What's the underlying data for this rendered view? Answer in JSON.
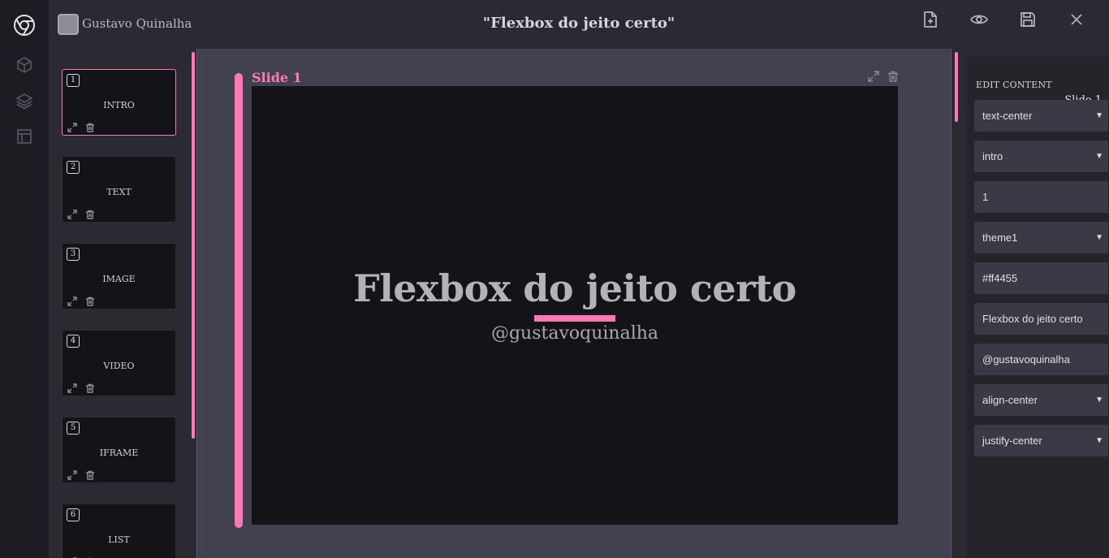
{
  "header": {
    "user_name": "Gustavo Quinalha",
    "doc_title": "\"Flexbox do jeito certo\"",
    "actions": [
      "new-file-icon",
      "eye-icon",
      "save-icon",
      "close-icon"
    ]
  },
  "rail": {
    "icons": [
      "chrome-logo-icon",
      "cube-icon",
      "layers-icon",
      "layout-icon"
    ]
  },
  "slides": [
    {
      "num": "1",
      "label": "INTRO"
    },
    {
      "num": "2",
      "label": "TEXT"
    },
    {
      "num": "3",
      "label": "IMAGE"
    },
    {
      "num": "4",
      "label": "VIDEO"
    },
    {
      "num": "5",
      "label": "IFRAME"
    },
    {
      "num": "6",
      "label": "LIST"
    }
  ],
  "canvas": {
    "slide_label": "Slide 1",
    "title": "Flexbox do jeito certo",
    "subtitle": "@gustavoquinalha"
  },
  "edit_panel": {
    "title": "EDIT CONTENT",
    "slide_label": "Slide 1",
    "fields": [
      {
        "value": "text-center",
        "type": "select"
      },
      {
        "value": "intro",
        "type": "select"
      },
      {
        "value": "1",
        "type": "input"
      },
      {
        "value": "theme1",
        "type": "select"
      },
      {
        "value": "#ff4455",
        "type": "input"
      },
      {
        "value": "Flexbox do jeito certo",
        "type": "input"
      },
      {
        "value": "@gustavoquinalha",
        "type": "input"
      },
      {
        "value": "align-center",
        "type": "select"
      },
      {
        "value": "justify-center",
        "type": "select"
      }
    ]
  },
  "colors": {
    "accent": "#ff77b7",
    "background": "#2b2a33",
    "slide_bg": "#141318"
  }
}
